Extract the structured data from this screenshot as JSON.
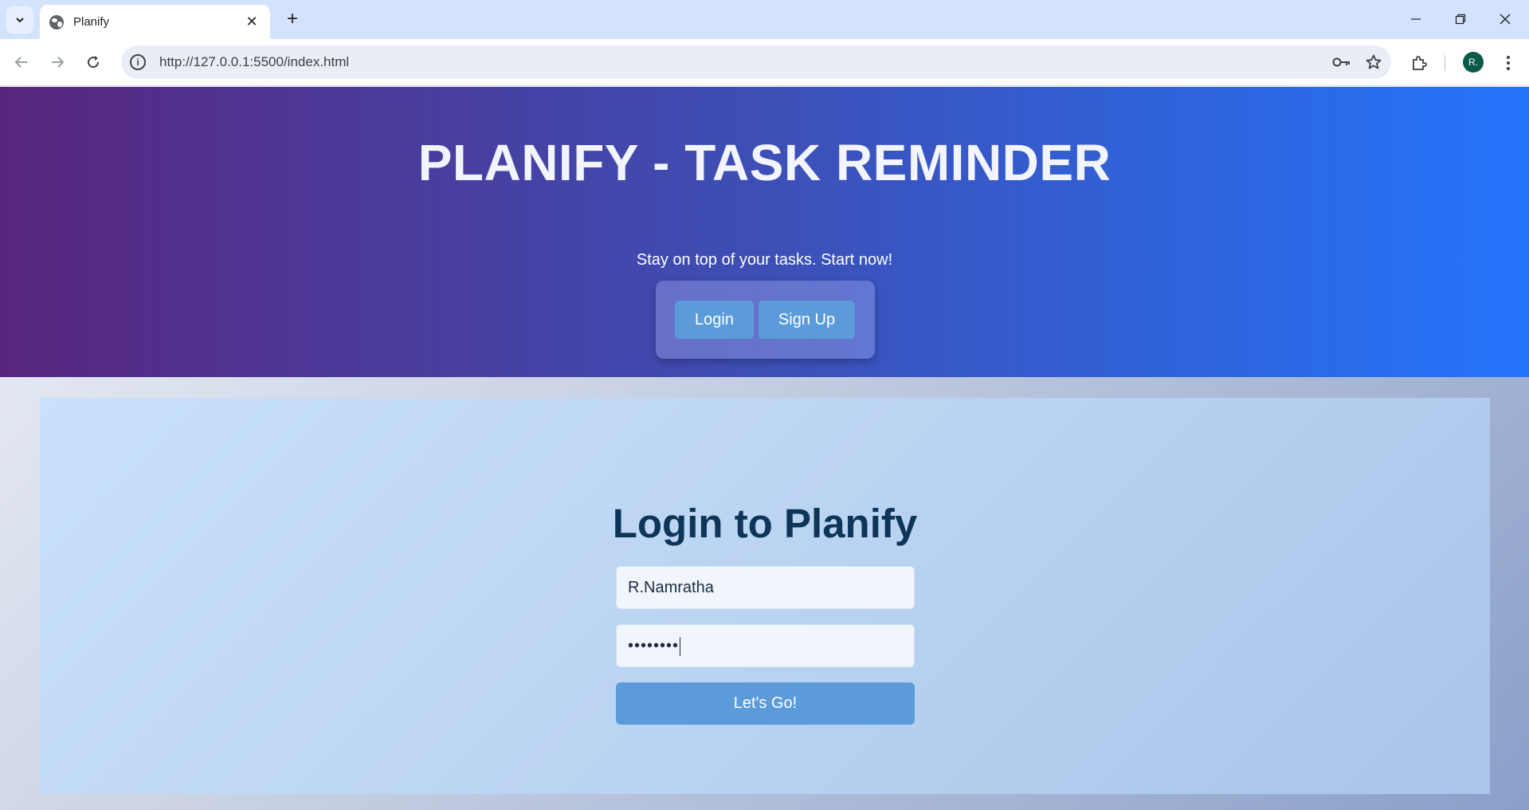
{
  "browser": {
    "tab_title": "Planify",
    "url": "http://127.0.0.1:5500/index.html",
    "profile_initial": "R."
  },
  "hero": {
    "title": "PLANIFY - TASK REMINDER",
    "subtitle": "Stay on top of your tasks. Start now!",
    "login_label": "Login",
    "signup_label": "Sign Up"
  },
  "login_form": {
    "title": "Login to Planify",
    "username_value": "R.Namratha",
    "password_masked": "••••••••",
    "submit_label": "Let's Go!"
  },
  "colors": {
    "hero_gradient_start": "#58267f",
    "hero_gradient_end": "#2474fb",
    "button": "#5b9bd9",
    "form_title": "#0c3558"
  },
  "icons": [
    "tab-search-icon",
    "globe-icon",
    "close-icon",
    "plus-icon",
    "minimize-icon",
    "restore-icon",
    "back-icon",
    "forward-icon",
    "reload-icon",
    "info-icon",
    "key-icon",
    "star-icon",
    "extensions-icon",
    "menu-icon"
  ]
}
